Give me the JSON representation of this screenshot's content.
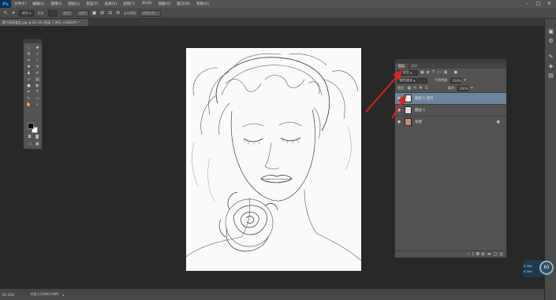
{
  "app": {
    "logo": "Ps"
  },
  "menubar": {
    "items": [
      "文件(F)",
      "编辑(E)",
      "图像(I)",
      "图层(L)",
      "类型(Y)",
      "选择(S)",
      "滤镜(T)",
      "3D(D)",
      "视图(V)",
      "窗口(W)",
      "帮助(H)"
    ],
    "window_controls": [
      "–",
      "□",
      "✕"
    ]
  },
  "options": {
    "tool_icon": "brush-icon",
    "style_select": "颜色",
    "sample_label": "仅选:",
    "button1": "更改",
    "button2": "相机",
    "auto_enhance": "自动增强",
    "refine_edge": "调整边缘..."
  },
  "doc_tab": {
    "title": "蒙古莉莉美女.jpg @ 83.3% (图层 1 拷贝, RGB/8#) *"
  },
  "layers": {
    "tabs": [
      "图层",
      "通道"
    ],
    "kind_filter": "ρ 类型",
    "blend_mode": "颜色减淡",
    "opacity_label": "不透明度:",
    "opacity_value": "100%",
    "lock_label": "锁定:",
    "fill_label": "填充:",
    "fill_value": "100%",
    "items": [
      {
        "name": "图层 1 拷贝",
        "selected": true
      },
      {
        "name": "图层 1",
        "selected": false
      },
      {
        "name": "背景",
        "selected": false
      }
    ],
    "footer_icons": [
      "link-icon",
      "fx-icon",
      "mask-icon",
      "adjustment-icon",
      "group-icon",
      "new-layer-icon",
      "trash-icon"
    ]
  },
  "status": {
    "zoom": "83.33%",
    "doc_info": "文档:1.63M/4.99M"
  },
  "net_widget": {
    "percent": "63",
    "up": "0.1K/s",
    "down": "0.2K/s"
  },
  "colors": {
    "selection": "#6c85a0",
    "annotation_arrow": "#e02020",
    "app_bg": "#282828"
  }
}
